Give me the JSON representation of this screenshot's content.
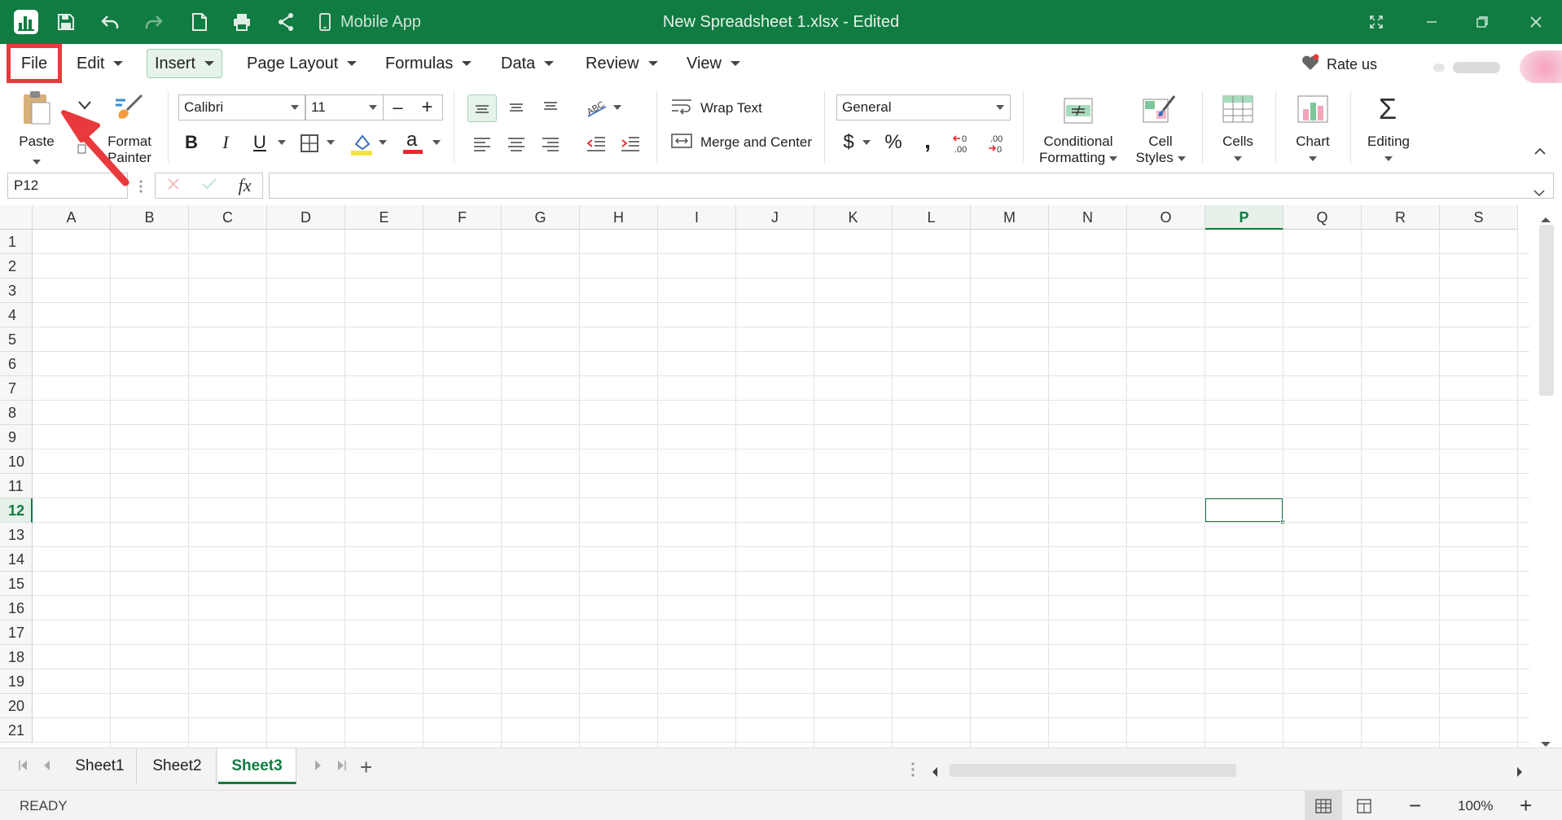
{
  "titlebar": {
    "mobile_app_label": "Mobile App",
    "document_title": "New Spreadsheet 1.xlsx - Edited",
    "background": "#107c41"
  },
  "menubar": {
    "items": [
      "File",
      "Edit",
      "Insert",
      "Page Layout",
      "Formulas",
      "Data",
      "Review",
      "View"
    ],
    "highlighted": "File",
    "selected": "Insert",
    "rate_us": "Rate us"
  },
  "ribbon": {
    "paste": "Paste",
    "format_painter_line1": "Format",
    "format_painter_line2": "Painter",
    "font_name": "Calibri",
    "font_size": "11",
    "wrap_text": "Wrap Text",
    "merge_center": "Merge and Center",
    "number_format": "General",
    "currency": "$",
    "percent": "%",
    "comma": ",",
    "conditional_line1": "Conditional",
    "conditional_line2": "Formatting",
    "cell_styles_line1": "Cell",
    "cell_styles_line2": "Styles",
    "cells": "Cells",
    "chart": "Chart",
    "editing": "Editing"
  },
  "formulabar": {
    "name_box": "P12",
    "fx": "fx",
    "formula": ""
  },
  "grid": {
    "columns": [
      "A",
      "B",
      "C",
      "D",
      "E",
      "F",
      "G",
      "H",
      "I",
      "J",
      "K",
      "L",
      "M",
      "N",
      "O",
      "P",
      "Q",
      "R",
      "S"
    ],
    "rows": [
      "1",
      "2",
      "3",
      "4",
      "5",
      "6",
      "7",
      "8",
      "9",
      "10",
      "11",
      "12",
      "13",
      "14",
      "15",
      "16",
      "17",
      "18",
      "19",
      "20",
      "21"
    ],
    "active_column": "P",
    "active_row": "12"
  },
  "sheets": {
    "tabs": [
      "Sheet1",
      "Sheet2",
      "Sheet3"
    ],
    "active": "Sheet3",
    "add": "+"
  },
  "status": {
    "text": "READY",
    "zoom": "100%",
    "zoom_out": "−",
    "zoom_in": "+"
  },
  "colors": {
    "accent": "#107c41",
    "highlight_box": "#e8393c",
    "annotation_arrow": "#e8393c"
  }
}
